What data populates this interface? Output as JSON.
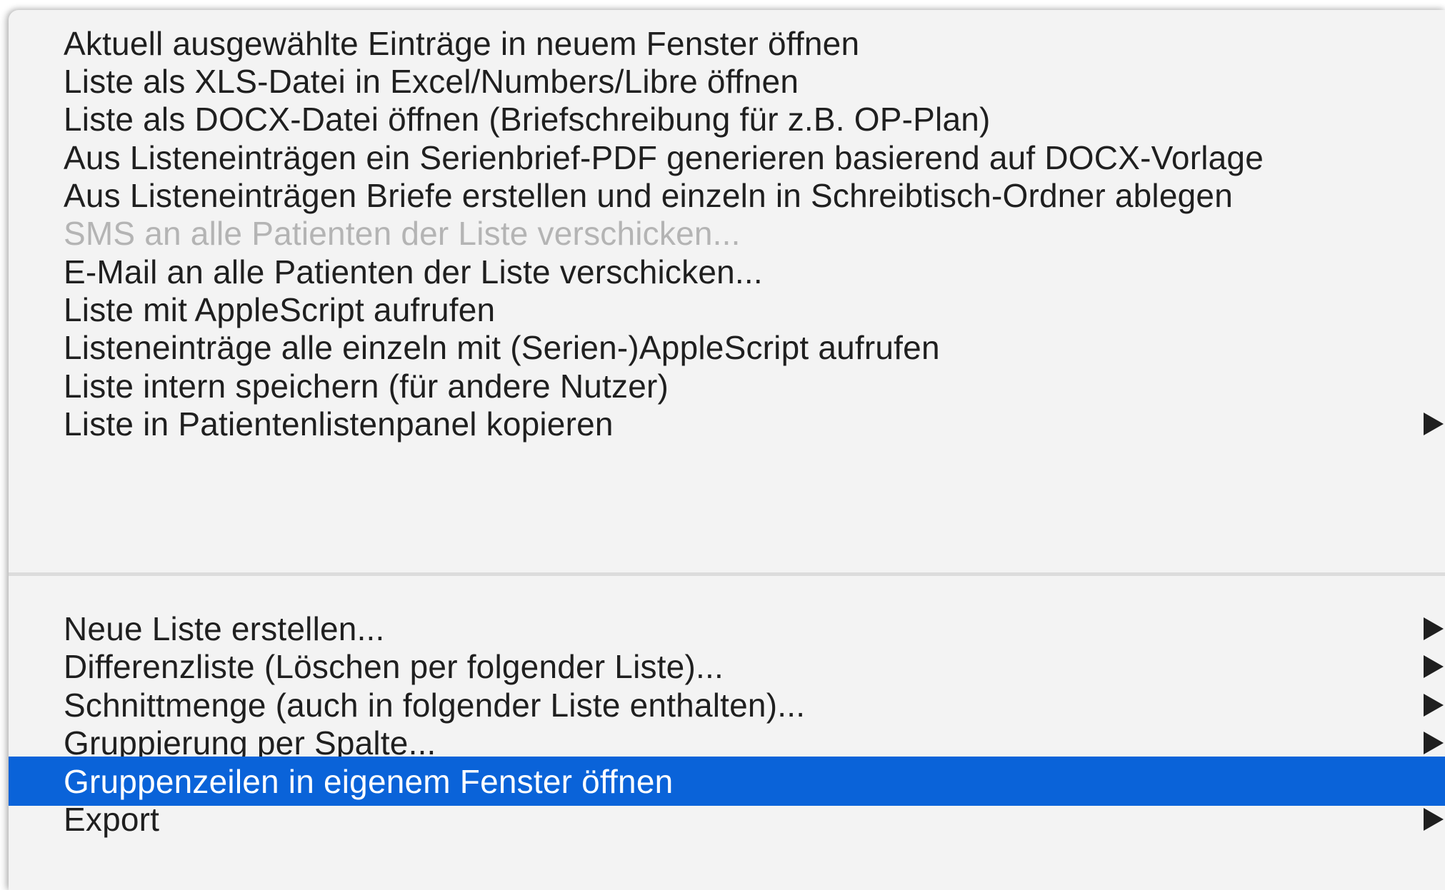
{
  "menu": {
    "items": [
      {
        "label": "Aktuell ausgewählte Einträge in neuem Fenster öffnen"
      },
      {
        "label": "Liste als XLS-Datei in Excel/Numbers/Libre öffnen"
      },
      {
        "label": "Liste als DOCX-Datei öffnen (Briefschreibung für z.B. OP-Plan)"
      },
      {
        "label": "Aus Listeneinträgen ein Serienbrief-PDF generieren basierend auf DOCX-Vorlage"
      },
      {
        "label": "Aus Listeneinträgen Briefe erstellen und einzeln in Schreibtisch-Ordner ablegen"
      },
      {
        "label": "SMS an alle Patienten der Liste verschicken...",
        "state": "disabled"
      },
      {
        "label": "E-Mail an alle Patienten der Liste verschicken..."
      },
      {
        "label": "Liste mit AppleScript aufrufen"
      },
      {
        "label": "Listeneinträge alle einzeln mit (Serien-)AppleScript aufrufen"
      },
      {
        "label": "Liste intern speichern (für andere Nutzer)"
      },
      {
        "label": "Liste in Patientenlistenpanel kopieren",
        "submenu": true
      },
      {
        "label": "Neue Liste erstellen...",
        "submenu": true
      },
      {
        "label": "Differenzliste (Löschen per folgender Liste)...",
        "submenu": true
      },
      {
        "label": "Schnittmenge (auch in folgender Liste enthalten)...",
        "submenu": true
      },
      {
        "label": "Gruppierung per Spalte...",
        "submenu": true
      },
      {
        "label": "Gruppenzeilen in eigenem Fenster öffnen",
        "state": "selected"
      },
      {
        "label": "Export",
        "submenu": true
      }
    ]
  },
  "colors": {
    "menu_background": "#f3f3f3",
    "selection": "#0a63d9",
    "text": "#1f1f1f",
    "disabled_text": "#b4b4b4"
  }
}
